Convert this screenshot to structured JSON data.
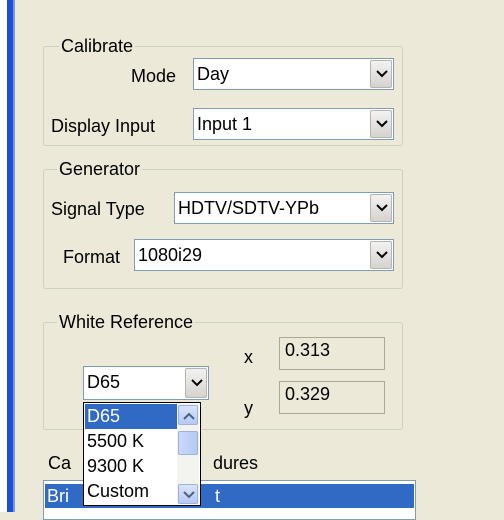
{
  "calibrate": {
    "legend": "Calibrate",
    "mode_label": "Mode",
    "mode_value": "Day",
    "display_input_label": "Display Input",
    "display_input_value": "Input 1"
  },
  "generator": {
    "legend": "Generator",
    "signal_type_label": "Signal Type",
    "signal_type_value": "HDTV/SDTV-YPb",
    "format_label": "Format",
    "format_value": "1080i29"
  },
  "white_reference": {
    "legend": "White Reference",
    "selected": "D65",
    "x_label": "x",
    "x_value": "0.313",
    "y_label": "y",
    "y_value": "0.329",
    "options": [
      "D65",
      "5500 K",
      "9300 K",
      "Custom"
    ]
  },
  "procedures": {
    "label_left": "Ca",
    "label_right": "dures",
    "selected_left": "Bri",
    "selected_right": "t"
  },
  "colors": {
    "window_bg": "#ece9d8",
    "selection": "#316ac5",
    "accent_strip": "#1d4fd6"
  }
}
